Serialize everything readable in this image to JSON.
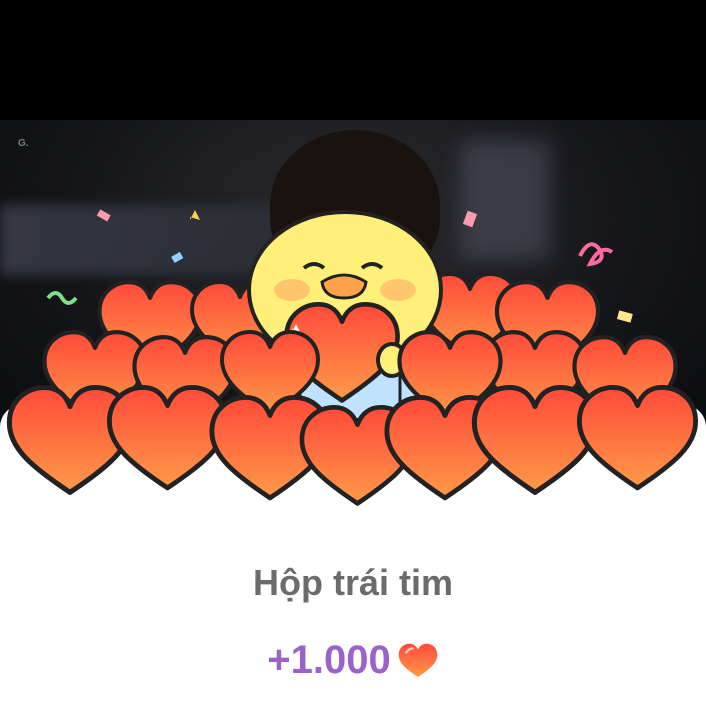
{
  "overlay": {
    "video_corner_mark": "G.",
    "reward_title": "Hộp trái tim",
    "reward_amount": "+1.000",
    "amount_icon": "heart-icon"
  },
  "colors": {
    "title": "#6b6b6b",
    "amount": "#9a63c9",
    "heart_fill": "#ff5a3c",
    "heart_fill_light": "#ff8a4c",
    "outline": "#222222",
    "chick": "#fff07a"
  }
}
